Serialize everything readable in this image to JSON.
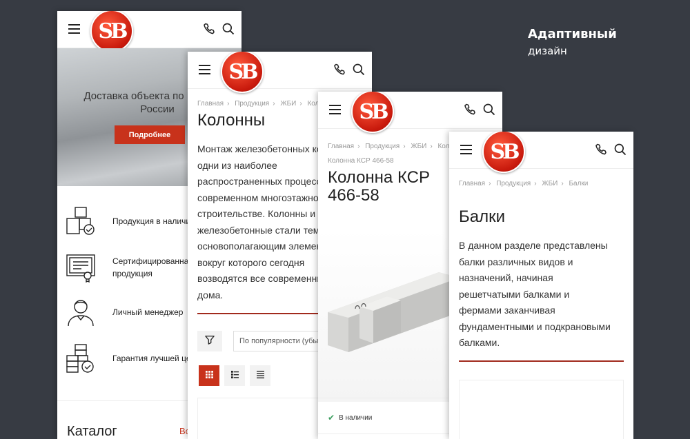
{
  "heading": {
    "title": "Адаптивный",
    "subtitle": "дизайн"
  },
  "logo": {
    "text": "SB",
    "color": "#d0240f"
  },
  "icons": {
    "menu": "menu-icon",
    "phone": "phone-icon",
    "search": "search-icon"
  },
  "phone1": {
    "hero_text": "Доставка объекта по Москве и России",
    "hero_button": "Подробнее",
    "features": [
      {
        "icon": "boxes-icon",
        "label": "Продукция в наличии"
      },
      {
        "icon": "certificate-icon",
        "label": "Сертифицированная продукция"
      },
      {
        "icon": "manager-icon",
        "label": "Личный менеджер"
      },
      {
        "icon": "guarantee-icon",
        "label": "Гарантия лучшей цены"
      }
    ],
    "catalog_title": "Каталог",
    "catalog_link": "Все"
  },
  "phone2": {
    "breadcrumbs": [
      "Главная",
      "Продукция",
      "ЖБИ",
      "Колонны"
    ],
    "title": "Колонны",
    "text": "Монтаж железобетонных колонн – одни из наиболее распространенных процессов в современном многоэтажном строительстве. Колонны и железобетонные стали тем основополагающим элементом, вокруг которого сегодня возводятся все современные дома.",
    "sort_value": "По популярности (убыв.)"
  },
  "phone3": {
    "breadcrumbs": [
      "Главная",
      "Продукция",
      "ЖБИ",
      "Колонны",
      "Колонна КСР 466-58"
    ],
    "title": "Колонна КСР 466-58",
    "stock": "В наличии"
  },
  "phone4": {
    "breadcrumbs": [
      "Главная",
      "Продукция",
      "ЖБИ",
      "Балки"
    ],
    "title": "Балки",
    "text": "В данном разделе представлены балки различных видов и назначений, начиная решетчатыми балками и фермами заканчивая фундаментными и подкрановыми балками."
  },
  "colors": {
    "accent": "#c8321b",
    "background": "#373b43",
    "stock": "#3a9d5d"
  }
}
